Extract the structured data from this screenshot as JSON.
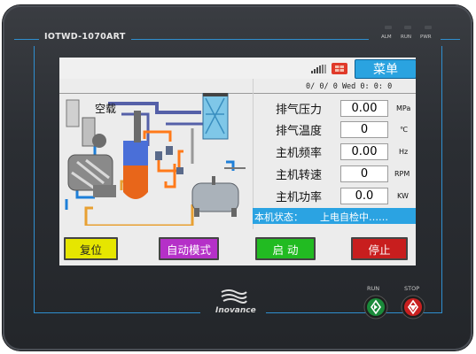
{
  "device": {
    "model": "IOTWD-1070ART",
    "leds": [
      "ALM",
      "RUN",
      "PWR"
    ],
    "brand": "Inovance",
    "hw_buttons": {
      "run_label": "RUN",
      "stop_label": "STOP"
    }
  },
  "screen": {
    "menu_label": "菜单",
    "datetime": "0/ 0/ 0 Wed  0: 0: 0",
    "diagram_label": "空载",
    "readings": [
      {
        "label": "排气压力",
        "value": "0.00",
        "unit": "MPa"
      },
      {
        "label": "排气温度",
        "value": "0",
        "unit": "℃"
      },
      {
        "label": "主机频率",
        "value": "0.00",
        "unit": "Hz"
      },
      {
        "label": "主机转速",
        "value": "0",
        "unit": "RPM"
      },
      {
        "label": "主机功率",
        "value": "0.0",
        "unit": "KW"
      }
    ],
    "status": {
      "label": "本机状态：",
      "value": "上电自检中……"
    },
    "buttons": [
      {
        "label": "复位",
        "color": "#e6e600"
      },
      {
        "label": "自动模式",
        "color": "#b530c8"
      },
      {
        "label": "启 动",
        "color": "#22bb22"
      },
      {
        "label": "停止",
        "color": "#c81e1e"
      }
    ]
  },
  "colors": {
    "accent": "#2aa3e0",
    "frame_line": "#2f8fd0"
  }
}
